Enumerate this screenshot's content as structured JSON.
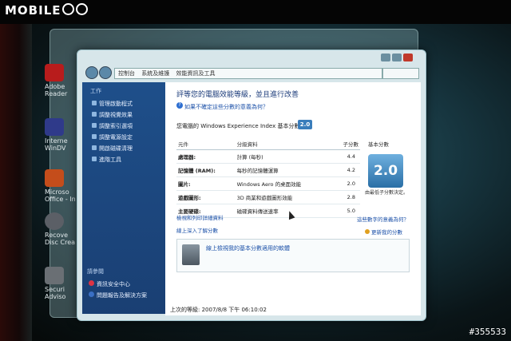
{
  "watermark": {
    "brand": "MOBILE",
    "photo_id": "#355533"
  },
  "desktop_icons": [
    {
      "label": "Adobe Reader",
      "color": "#b81c1c"
    },
    {
      "label": "Interne WinDV",
      "color": "#2f3a8a"
    },
    {
      "label": "Microso Office - In",
      "color": "#c44d1b"
    },
    {
      "label": "Recove Disc Crea",
      "color": "#5b5f66"
    },
    {
      "label": "Securi Adviso",
      "color": "#6a6f74"
    }
  ],
  "window": {
    "breadcrumbs": [
      "控制台",
      "系統及維護",
      "效能資訊及工具"
    ],
    "sidebar": {
      "title": "工作",
      "items": [
        "管理啟動程式",
        "調整視覺效果",
        "調整索引選項",
        "調整電源設定",
        "開啟磁碟清理",
        "進階工具"
      ],
      "see_also_title": "請參閱",
      "see_also": [
        "資訊安全中心",
        "問題報告及解決方案"
      ]
    },
    "heading": "評等您的電腦效能等級，並且進行改善",
    "help_link": "如果不確定這些分數的意義為何？",
    "base_score_text": "您電腦的 Windows Experience Index 基本分數為",
    "base_score": "2.0",
    "table": {
      "headers": [
        "元件",
        "分級資料",
        "子分數"
      ],
      "rows": [
        {
          "component": "處理器:",
          "detail": "計算 (每秒)",
          "score": "4.4"
        },
        {
          "component": "記憶體 (RAM):",
          "detail": "每秒的記憶體運算",
          "score": "4.2"
        },
        {
          "component": "圖片:",
          "detail": "Windows Aero 的桌面效能",
          "score": "2.0"
        },
        {
          "component": "遊戲圖形:",
          "detail": "3D 商業和遊戲圖形效能",
          "score": "2.8"
        },
        {
          "component": "主要硬碟:",
          "detail": "磁碟資料傳送速率",
          "score": "5.0"
        }
      ]
    },
    "base_score_header": "基本分數",
    "badge_caption": "由最低子分數決定。",
    "link_view_details": "檢視和列印詳細資料",
    "link_learn_more": "線上深入了解分數",
    "link_what_does_it_mean": "這些數字的意義為何？",
    "link_update": "更新我的分數",
    "update_box_text": "線上檢視我的基本分數適用的軟體",
    "last_rated": "上次的等級: 2007/8/8 下午 06:10:02"
  }
}
